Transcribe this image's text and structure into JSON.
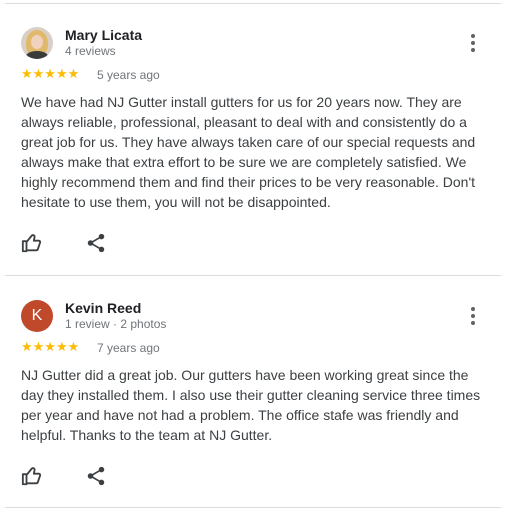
{
  "reviews": [
    {
      "name": "Mary Licata",
      "meta": "4 reviews",
      "avatar_type": "photo",
      "stars": "★★★★★",
      "rating": 5,
      "age": "5 years ago",
      "text": "We have had NJ Gutter install gutters for us for 20 years now. They are always reliable, professional, pleasant to deal with and consistently do a great job for us. They have always taken care of our special requests and always make that extra effort to be sure we are completely satisfied. We highly recommend them and find their prices to be very reasonable. Don't hesitate to use them, you will not be disappointed."
    },
    {
      "name": "Kevin Reed",
      "meta": "1 review · 2 photos",
      "avatar_letter": "K",
      "avatar_color": "#c0492c",
      "stars": "★★★★★",
      "rating": 5,
      "age": "7 years ago",
      "text": "NJ Gutter did a great job. Our gutters have been working great since the day they installed them. I also use their gutter cleaning service three times per year and have not had a problem. The office stafe was friendly and helpful. Thanks to the team at NJ Gutter."
    }
  ],
  "icons": {
    "like": "thumbs-up-icon",
    "share": "share-icon",
    "menu": "more-vert-icon"
  },
  "colors": {
    "star": "#fbbc04",
    "divider": "#dadce0"
  }
}
